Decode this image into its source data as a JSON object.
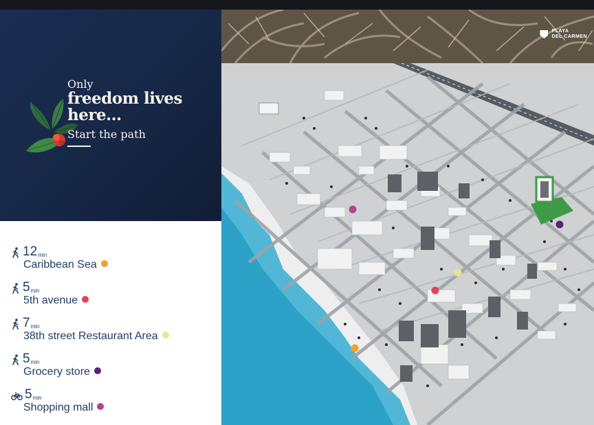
{
  "hero": {
    "line1": "Only",
    "line2": "freedom lives",
    "line3": "here...",
    "line4": "Start the path"
  },
  "logo": {
    "line1": "PLAYA",
    "line2": "DEL CARMEN"
  },
  "items": [
    {
      "mode": "walk-icon",
      "number": "12",
      "unit": "min",
      "label": "Caribbean Sea",
      "color": "#f0a32e"
    },
    {
      "mode": "walk-icon",
      "number": "5",
      "unit": "min",
      "label": "5th avenue",
      "color": "#e0435a"
    },
    {
      "mode": "walk-icon",
      "number": "7",
      "unit": "min",
      "label": "38th street Restaurant Area",
      "color": "#e4e597"
    },
    {
      "mode": "walk-icon",
      "number": "5",
      "unit": "min",
      "label": "Grocery store",
      "color": "#5a2176"
    },
    {
      "mode": "bike-icon",
      "number": "5",
      "unit": "min",
      "label": "Shopping mall",
      "color": "#b1438f"
    }
  ],
  "map_markers": [
    {
      "name": "caribbean-sea-marker",
      "color": "#f0a32e"
    },
    {
      "name": "fifth-avenue-marker",
      "color": "#e0435a"
    },
    {
      "name": "restaurant-area-marker",
      "color": "#e4e597"
    },
    {
      "name": "grocery-store-marker",
      "color": "#5a2176"
    },
    {
      "name": "shopping-mall-marker",
      "color": "#b1438f"
    }
  ]
}
